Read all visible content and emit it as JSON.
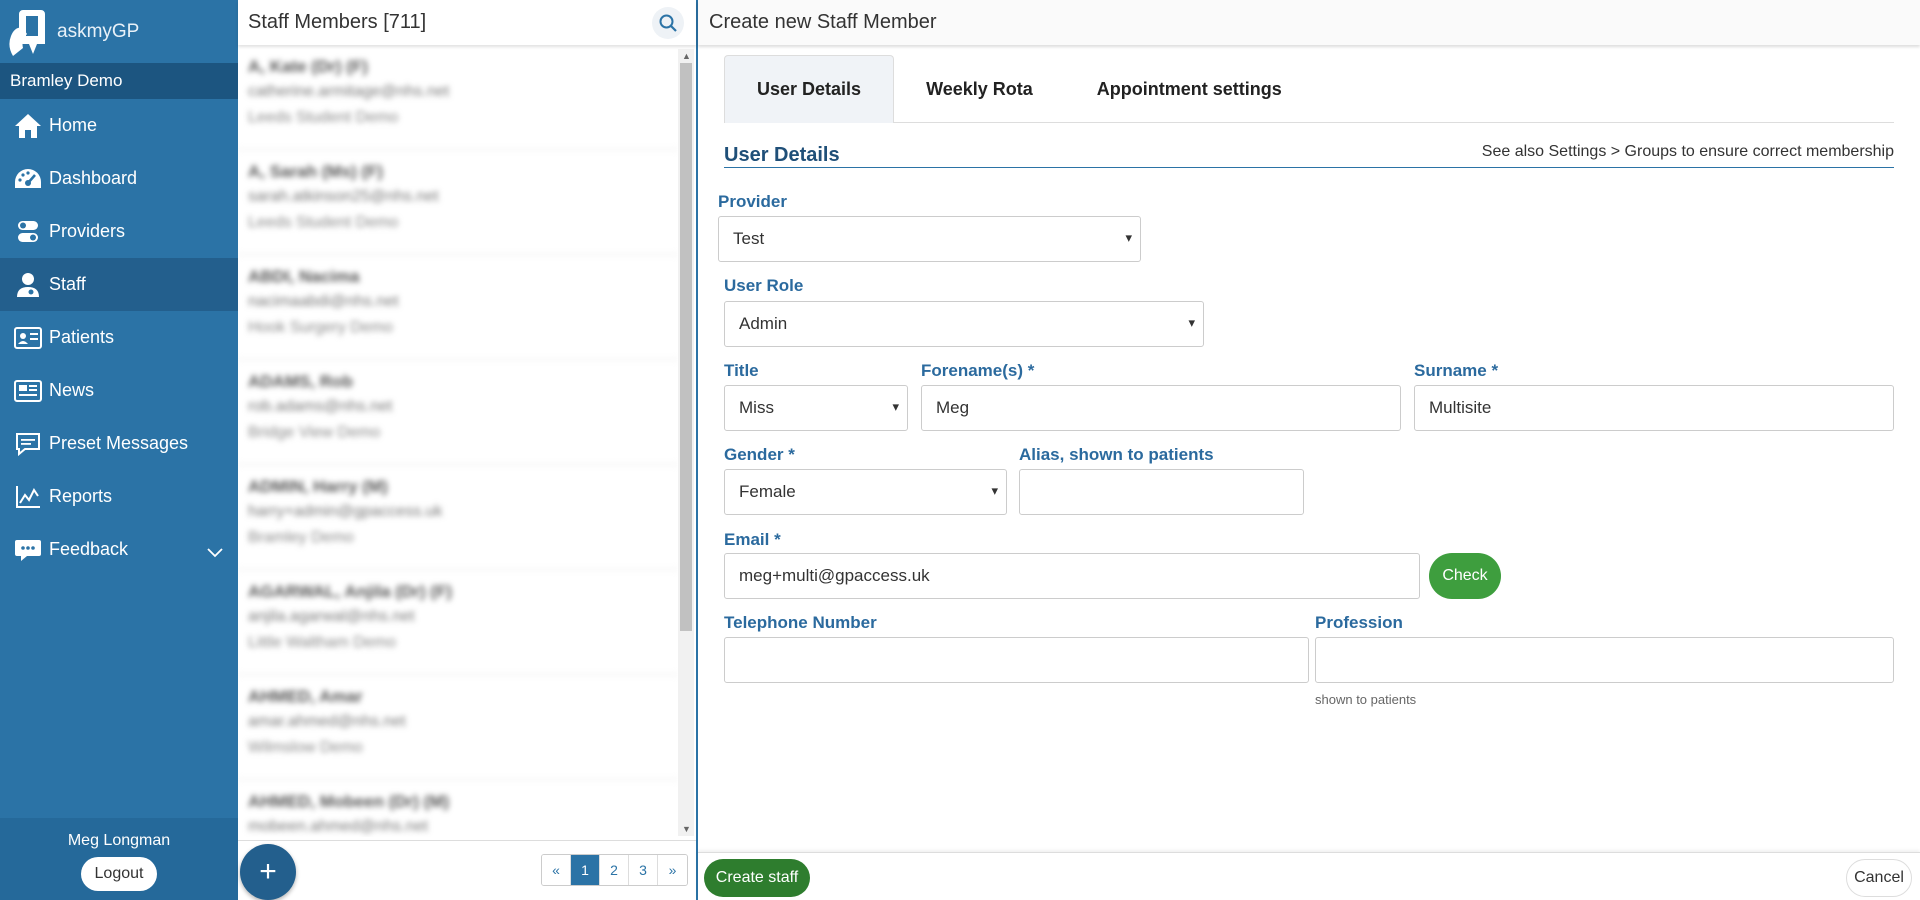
{
  "app": {
    "logo_text": "askmyGP",
    "practice": "Bramley Demo"
  },
  "sidebar": {
    "items": [
      {
        "label": "Home",
        "icon": "home-icon"
      },
      {
        "label": "Dashboard",
        "icon": "dashboard-icon"
      },
      {
        "label": "Providers",
        "icon": "providers-icon"
      },
      {
        "label": "Staff",
        "icon": "staff-icon",
        "active": true
      },
      {
        "label": "Patients",
        "icon": "patient-card-icon"
      },
      {
        "label": "News",
        "icon": "news-icon"
      },
      {
        "label": "Preset Messages",
        "icon": "chat-icon"
      },
      {
        "label": "Reports",
        "icon": "chart-icon"
      },
      {
        "label": "Feedback",
        "icon": "feedback-icon"
      }
    ],
    "user_name": "Meg Longman",
    "logout_label": "Logout"
  },
  "staff_list": {
    "title": "Staff Members [711]",
    "items": [
      {
        "name": "A, Kate (Dr) (F)",
        "email": "catherine.armitage@nhs.net",
        "org": "Leeds Student Demo"
      },
      {
        "name": "A, Sarah (Ms) (F)",
        "email": "sarah.atkinson25@nhs.net",
        "org": "Leeds Student Demo"
      },
      {
        "name": "ABDI, Nacima",
        "email": "nacimaabdi@nhs.net",
        "org": "Hook Surgery Demo"
      },
      {
        "name": "ADAMS, Rob",
        "email": "rob.adams@nhs.net",
        "org": "Bridge View Demo"
      },
      {
        "name": "ADMIN, Harry (M)",
        "email": "harry+admin@gpaccess.uk",
        "org": "Bramley Demo"
      },
      {
        "name": "AGARWAL, Anjila (Dr) (F)",
        "email": "anjila.agarwal@nhs.net",
        "org": "Little Waltham Demo"
      },
      {
        "name": "AHMED, Amar",
        "email": "amar.ahmed@nhs.net",
        "org": "Wilmslow Demo"
      },
      {
        "name": "AHMED, Mobeen (Dr) (M)",
        "email": "mobeen.ahmed@nhs.net",
        "org": ""
      }
    ],
    "pager": {
      "prev": "«",
      "pages": [
        "1",
        "2",
        "3"
      ],
      "next": "»",
      "current": "1"
    },
    "add_label": "+"
  },
  "form": {
    "header": "Create new Staff Member",
    "tabs": [
      "User Details",
      "Weekly Rota",
      "Appointment settings"
    ],
    "section_title": "User Details",
    "section_note": "See also Settings > Groups to ensure correct membership",
    "provider": {
      "label": "Provider",
      "value": "Test"
    },
    "user_role": {
      "label": "User Role",
      "value": "Admin"
    },
    "title": {
      "label": "Title",
      "value": "Miss"
    },
    "forename": {
      "label": "Forename(s) *",
      "value": "Meg"
    },
    "surname": {
      "label": "Surname *",
      "value": "Multisite"
    },
    "gender": {
      "label": "Gender *",
      "value": "Female"
    },
    "alias": {
      "label": "Alias, shown to patients",
      "value": ""
    },
    "email": {
      "label": "Email *",
      "value": "meg+multi@gpaccess.uk",
      "check_label": "Check"
    },
    "telephone": {
      "label": "Telephone Number",
      "value": ""
    },
    "profession": {
      "label": "Profession",
      "value": "",
      "hint": "shown to patients"
    },
    "create_label": "Create staff",
    "cancel_label": "Cancel"
  },
  "colors": {
    "sidebar": "#2b73a6",
    "accent": "#2b73a6",
    "success": "#3e9e3e"
  }
}
